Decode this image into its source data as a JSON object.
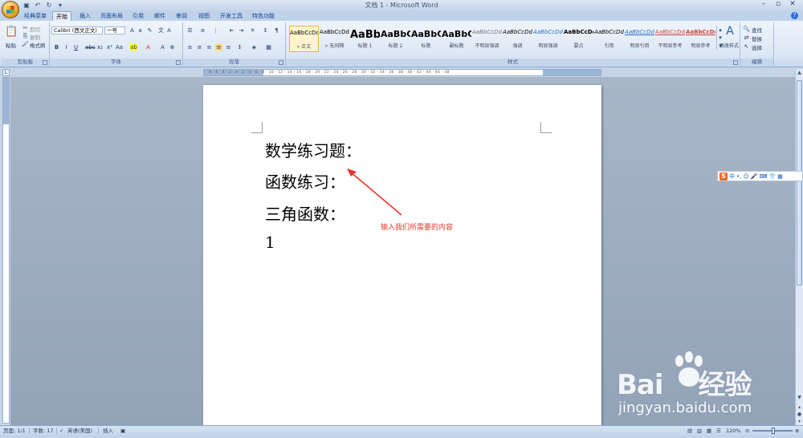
{
  "window": {
    "title": "文档 1 - Microsoft Word"
  },
  "tabs": [
    {
      "label": "经典菜单"
    },
    {
      "label": "开始",
      "active": true
    },
    {
      "label": "插入"
    },
    {
      "label": "页面布局"
    },
    {
      "label": "引用"
    },
    {
      "label": "邮件"
    },
    {
      "label": "审阅"
    },
    {
      "label": "视图"
    },
    {
      "label": "开发工具"
    },
    {
      "label": "特色功能"
    }
  ],
  "ribbon": {
    "clipboard": {
      "label": "剪贴板",
      "paste": "粘贴",
      "cut": "剪切",
      "copy": "复制",
      "format_painter": "格式刷"
    },
    "font": {
      "label": "字体",
      "font_name": "Calibri (西文正文)",
      "font_size": "一号"
    },
    "paragraph": {
      "label": "段落"
    },
    "styles": {
      "label": "样式",
      "change_styles": "更改样式",
      "items": [
        {
          "sample": "AaBbCcDd",
          "name": "» 正文",
          "selected": true
        },
        {
          "sample": "AaBbCcDd",
          "name": "» 无间隔"
        },
        {
          "sample": "AaBb",
          "name": "标题 1"
        },
        {
          "sample": "AaBbC",
          "name": "标题 2"
        },
        {
          "sample": "AaBbC",
          "name": "标题"
        },
        {
          "sample": "AaBbC",
          "name": "副标题"
        },
        {
          "sample": "AaBbCcDd",
          "name": "不明显强调"
        },
        {
          "sample": "AaBbCcDd",
          "name": "强调"
        },
        {
          "sample": "AaBbCcDd",
          "name": "明显强调"
        },
        {
          "sample": "AaBbCcDd",
          "name": "要点"
        },
        {
          "sample": "AaBbCcDd",
          "name": "引用"
        },
        {
          "sample": "AaBbCcDd",
          "name": "明显引用"
        },
        {
          "sample": "AaBbCcDd",
          "name": "不明显参考"
        },
        {
          "sample": "AaBbCcDd",
          "name": "明显参考"
        }
      ]
    },
    "editing": {
      "label": "编辑",
      "find": "查找",
      "replace": "替换",
      "select": "选择"
    }
  },
  "ruler": {
    "top_ticks": "8 · 6 · 4 · 2 · ▾ · 2 · 4 · 6 · 8 · 10 · 12 · 14 · 16 · 18 · 20 · 22 · 24 · 26 · 28 · 30 · 32 · 34 · 36 · 38 · 40 · 42 · 44 · 46 · 48"
  },
  "document": {
    "lines": [
      "数学练习题：",
      "函数练习：",
      "三角函数：",
      "1"
    ]
  },
  "annotation": {
    "text": "输入我们所需要的内容",
    "color": "#e8352b"
  },
  "ime": {
    "logo": "S",
    "mode": "中"
  },
  "statusbar": {
    "page": "页面: 1/1",
    "words": "字数: 17",
    "language": "英语(美国)",
    "insert_mode": "插入",
    "zoom": "120%"
  },
  "watermark": {
    "brand_left": "Bai",
    "brand_right": "经验",
    "url": "jingyan.baidu.com"
  }
}
